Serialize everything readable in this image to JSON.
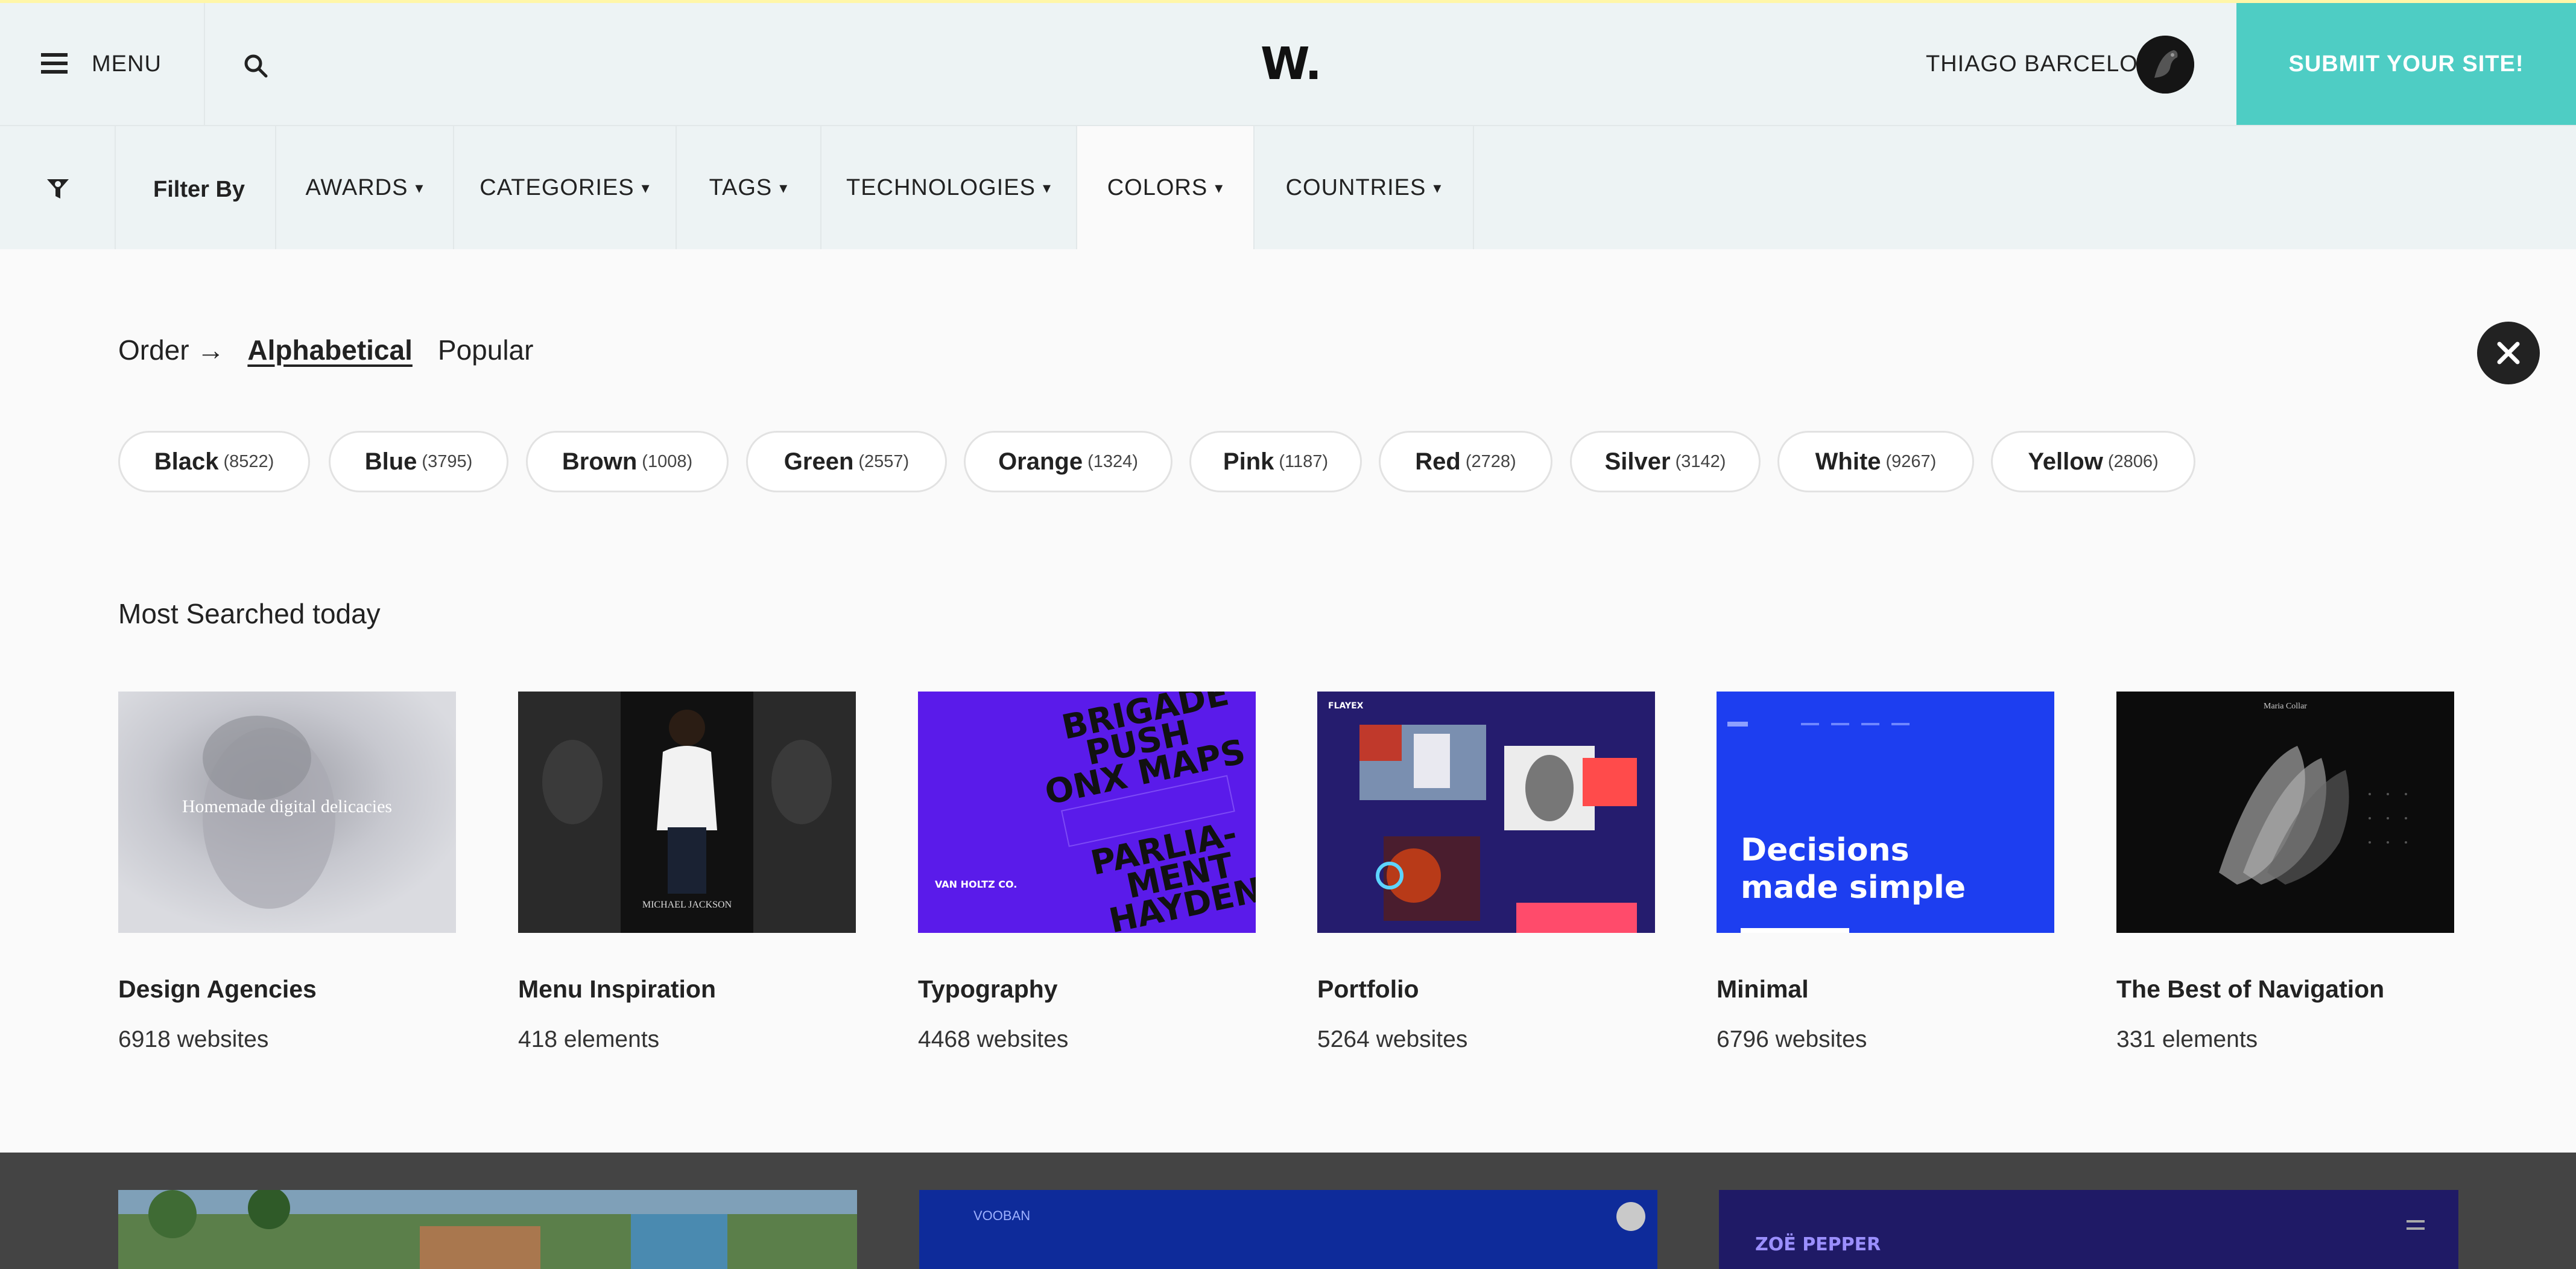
{
  "header": {
    "menu_label": "MENU",
    "logo": "W.",
    "user_name": "THIAGO BARCELOS",
    "submit_label": "SUBMIT YOUR SITE!",
    "submit_color": "#4ecdc4"
  },
  "filters": {
    "label": "Filter By",
    "items": [
      {
        "label": "AWARDS",
        "caret": "▾"
      },
      {
        "label": "CATEGORIES",
        "caret": "▾"
      },
      {
        "label": "TAGS",
        "caret": "▾"
      },
      {
        "label": "TECHNOLOGIES",
        "caret": "▾"
      },
      {
        "label": "COLORS",
        "caret": "▾",
        "active": true
      },
      {
        "label": "COUNTRIES",
        "caret": "▾"
      }
    ]
  },
  "order": {
    "label": "Order →",
    "options": [
      "Alphabetical",
      "Popular"
    ],
    "selected": "Alphabetical"
  },
  "colors": [
    {
      "name": "Black",
      "count": "(8522)"
    },
    {
      "name": "Blue",
      "count": "(3795)"
    },
    {
      "name": "Brown",
      "count": "(1008)"
    },
    {
      "name": "Green",
      "count": "(2557)"
    },
    {
      "name": "Orange",
      "count": "(1324)"
    },
    {
      "name": "Pink",
      "count": "(1187)"
    },
    {
      "name": "Red",
      "count": "(2728)"
    },
    {
      "name": "Silver",
      "count": "(3142)"
    },
    {
      "name": "White",
      "count": "(9267)"
    },
    {
      "name": "Yellow",
      "count": "(2806)"
    }
  ],
  "most_searched": {
    "title": "Most Searched today",
    "cards": [
      {
        "title": "Design Agencies",
        "count": "6918 websites",
        "thumb_text": "Homemade digital delicacies"
      },
      {
        "title": "Menu Inspiration",
        "count": "418 elements",
        "thumb_text": "MICHAEL JACKSON"
      },
      {
        "title": "Typography",
        "count": "4468 websites",
        "thumb_text": [
          "BRIGADE",
          "PUSH",
          "ONX MAPS",
          "PARLIA-",
          "MENT",
          "HAYDEN",
          "VAN HOLTZ CO."
        ]
      },
      {
        "title": "Portfolio",
        "count": "5264 websites",
        "thumb_text": "FLAYEX"
      },
      {
        "title": "Minimal",
        "count": "6796 websites",
        "thumb_text": [
          "Decisions",
          "made simple"
        ]
      },
      {
        "title": "The Best of Navigation",
        "count": "331 elements",
        "thumb_text": "Maria Collar"
      }
    ]
  },
  "bottom": {
    "thumb_texts": [
      "VOOBAN",
      "ZOË PEPPER"
    ]
  },
  "icons": {
    "menu": "hamburger-icon",
    "search": "search-icon",
    "filter": "filter-icon",
    "close": "close-icon"
  }
}
